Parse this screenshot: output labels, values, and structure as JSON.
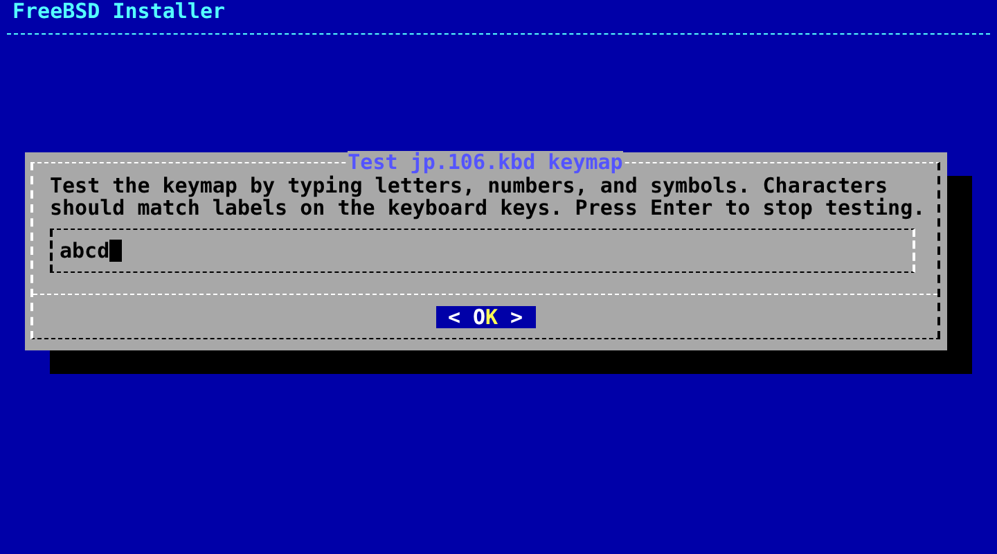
{
  "header": {
    "title": "FreeBSD Installer"
  },
  "dialog": {
    "title": "Test jp.106.kbd keymap",
    "message": "Test the keymap by typing letters, numbers, and symbols. Characters should match labels on the keyboard keys. Press Enter to stop testing.",
    "input": {
      "value": "abcd",
      "focused": true
    },
    "buttons": [
      {
        "left": "<",
        "label": "OK",
        "right": ">",
        "selected": true
      }
    ]
  }
}
